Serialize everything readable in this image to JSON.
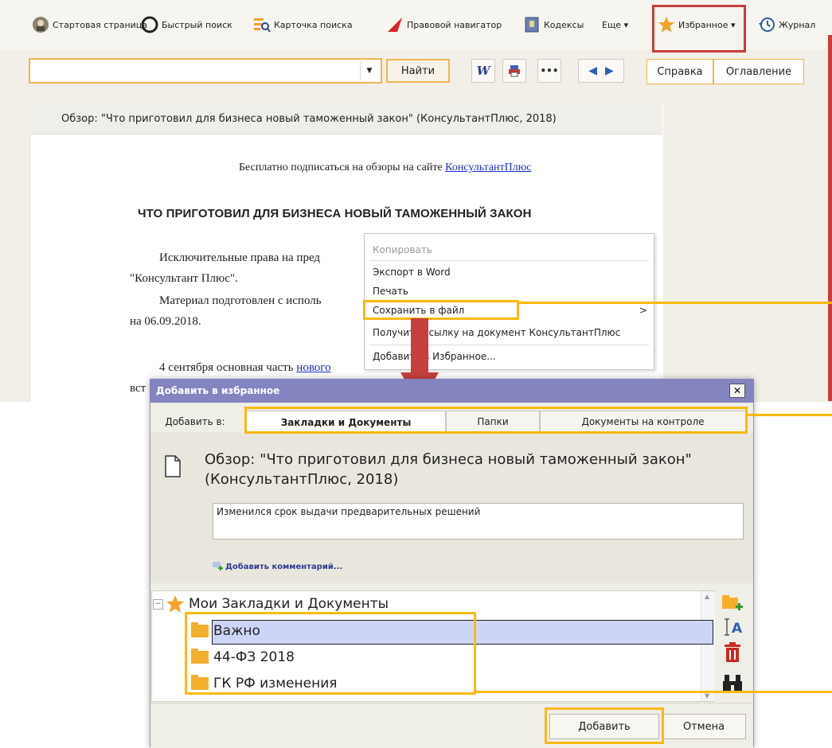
{
  "toolbar": {
    "items": [
      {
        "label": "Стартовая страница"
      },
      {
        "label": "Быстрый поиск"
      },
      {
        "label": "Карточка поиска"
      },
      {
        "label": "Правовой навигатор"
      },
      {
        "label": "Кодексы"
      },
      {
        "label": "Еще ▾"
      },
      {
        "label": "Избранное ▾"
      },
      {
        "label": "Журнал"
      }
    ]
  },
  "search": {
    "value": "",
    "find_label": "Найти"
  },
  "nav": {
    "help_label": "Справка",
    "toc_label": "Оглавление"
  },
  "document": {
    "header": "Обзор: \"Что приготовил для бизнеса новый таможенный закон\" (КонсультантПлюс, 2018)",
    "subscribe_text": "Бесплатно подписаться на обзоры на сайте ",
    "subscribe_link": "КонсультантПлюс",
    "title": "ЧТО ПРИГОТОВИЛ ДЛЯ БИЗНЕСА НОВЫЙ ТАМОЖЕННЫЙ ЗАКОН",
    "p1_line1": "Исключительные права на пред",
    "p1_line2": "\"Консультант Плюс\".",
    "p2_line1": "Материал подготовлен с исполь",
    "p2_line2": "на 06.09.2018.",
    "p3_line1": "4 сентября основная часть ",
    "p3_link": "нового",
    "p3_line2": "вст"
  },
  "context_menu": {
    "items": [
      {
        "label": "Копировать",
        "disabled": true
      },
      {
        "label": "Экспорт в Word"
      },
      {
        "label": "Печать"
      },
      {
        "label": "Сохранить в файл"
      },
      {
        "label": "Получить ссылку на документ КонсультантПлюс"
      },
      {
        "label": "Добавить в Избранное..."
      }
    ],
    "submenu_arrow": ">"
  },
  "dialog": {
    "title": "Добавить в избранное",
    "close_glyph": "✕",
    "add_to_label": "Добавить в:",
    "tabs": [
      {
        "label": "Закладки и Документы"
      },
      {
        "label": "Папки"
      },
      {
        "label": "Документы на контроле"
      }
    ],
    "doc_name_line1": "Обзор: \"Что приготовил для бизнеса новый таможенный закон\"",
    "doc_name_line2": "(КонсультантПлюс, 2018)",
    "comment": "Изменился срок выдачи предварительных решений",
    "add_comment_label": "Добавить комментарий...",
    "tree": {
      "root": "Мои Закладки и Документы",
      "expander": "−",
      "folders": [
        {
          "label": "Важно",
          "selected": true
        },
        {
          "label": "44-ФЗ 2018"
        },
        {
          "label": "ГК РФ изменения"
        }
      ]
    },
    "add_button": "Добавить",
    "cancel_button": "Отмена"
  },
  "colors": {
    "accent_highlight": "#f8b912",
    "callout_red": "#c63f3d",
    "dialog_titlebar": "#8384c0",
    "selection": "#cdd5f7",
    "folder": "#f6ae2d",
    "link": "#1a2fd0"
  }
}
